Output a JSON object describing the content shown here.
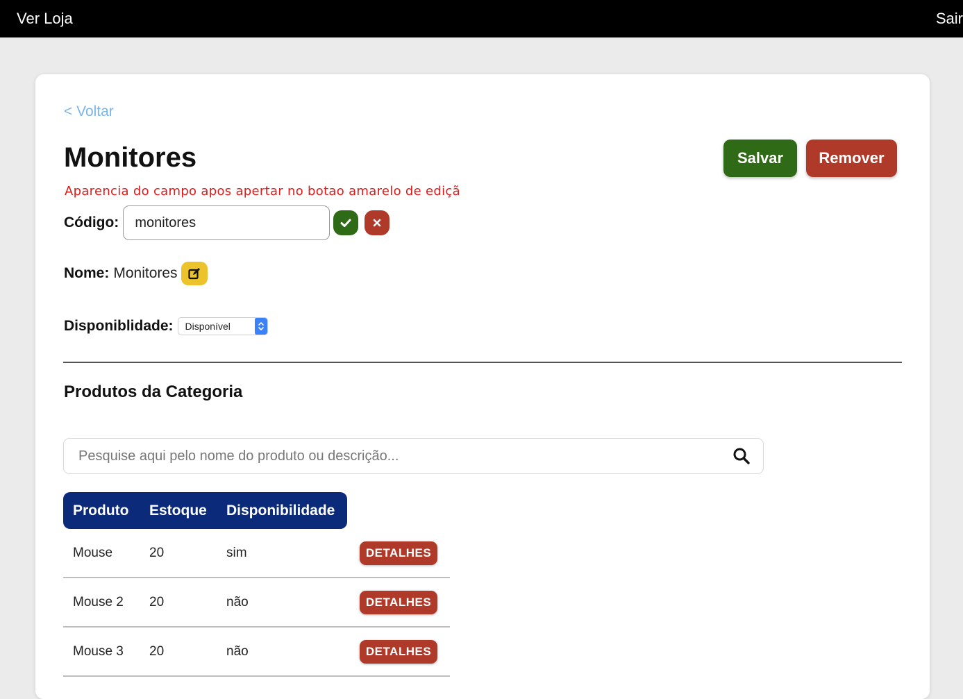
{
  "topbar": {
    "brand": "Ver Loja",
    "logout": "Sair"
  },
  "page": {
    "back_label": "< Voltar",
    "title": "Monitores",
    "save_label": "Salvar",
    "remove_label": "Remover",
    "note": "Aparencia do campo apos apertar no botao amarelo de ediçã"
  },
  "form": {
    "codigo_label": "Código:",
    "codigo_value": "monitores",
    "nome_label": "Nome:",
    "nome_value": "Monitores",
    "disp_label": "Disponiblidade:",
    "disp_selected": "Disponível"
  },
  "products": {
    "section_title": "Produtos da Categoria",
    "search_placeholder": "Pesquise aqui pelo nome do produto ou descrição...",
    "columns": [
      "Produto",
      "Estoque",
      "Disponibilidade"
    ],
    "details_label": "DETALHES",
    "rows": [
      {
        "produto": "Mouse",
        "estoque": "20",
        "disponibilidade": "sim"
      },
      {
        "produto": "Mouse 2",
        "estoque": "20",
        "disponibilidade": "não"
      },
      {
        "produto": "Mouse 3",
        "estoque": "20",
        "disponibilidade": "não"
      }
    ]
  },
  "colors": {
    "save": "#2f6a17",
    "remove": "#b03a2a",
    "edit": "#ecc32c",
    "table_header": "#0b2a7a",
    "link": "#7ab6ec",
    "note": "#e01919"
  },
  "icons": {
    "confirm": "check-icon",
    "cancel": "close-icon",
    "edit": "edit-icon",
    "search": "search-icon",
    "select": "chevron-updown-icon"
  }
}
